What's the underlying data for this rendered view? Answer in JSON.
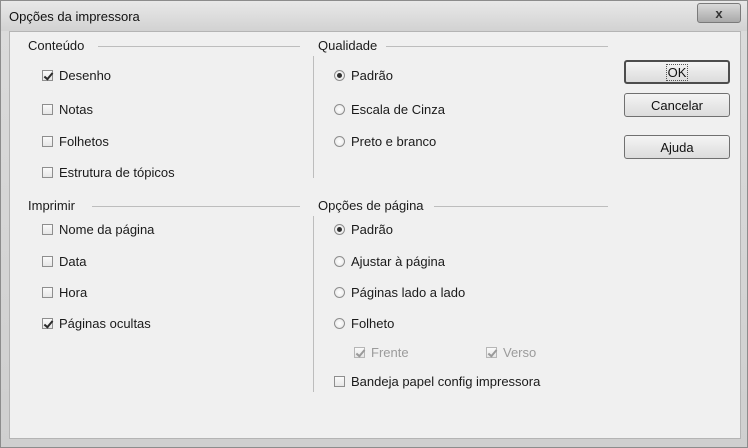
{
  "window": {
    "title": "Opções da impressora",
    "close_label": "x"
  },
  "conteudo": {
    "label": "Conteúdo",
    "items": [
      {
        "label": "Desenho",
        "checked": true
      },
      {
        "label": "Notas",
        "checked": false
      },
      {
        "label": "Folhetos",
        "checked": false
      },
      {
        "label": "Estrutura de tópicos",
        "checked": false
      }
    ]
  },
  "qualidade": {
    "label": "Qualidade",
    "items": [
      {
        "label": "Padrão",
        "selected": true
      },
      {
        "label": "Escala de Cinza",
        "selected": false
      },
      {
        "label": "Preto e branco",
        "selected": false
      }
    ]
  },
  "imprimir": {
    "label": "Imprimir",
    "items": [
      {
        "label": "Nome da página",
        "checked": false
      },
      {
        "label": "Data",
        "checked": false
      },
      {
        "label": "Hora",
        "checked": false
      },
      {
        "label": "Páginas ocultas",
        "checked": true
      }
    ]
  },
  "opcoes_pagina": {
    "label": "Opções de página",
    "items": [
      {
        "label": "Padrão",
        "selected": true
      },
      {
        "label": "Ajustar à página",
        "selected": false
      },
      {
        "label": "Páginas lado a lado",
        "selected": false
      },
      {
        "label": "Folheto",
        "selected": false
      }
    ],
    "frente": {
      "label": "Frente",
      "checked": true,
      "disabled": true
    },
    "verso": {
      "label": "Verso",
      "checked": true,
      "disabled": true
    },
    "bandeja": {
      "label": "Bandeja papel config impressora",
      "checked": false
    }
  },
  "buttons": {
    "ok": "OK",
    "cancel": "Cancelar",
    "help": "Ajuda"
  }
}
